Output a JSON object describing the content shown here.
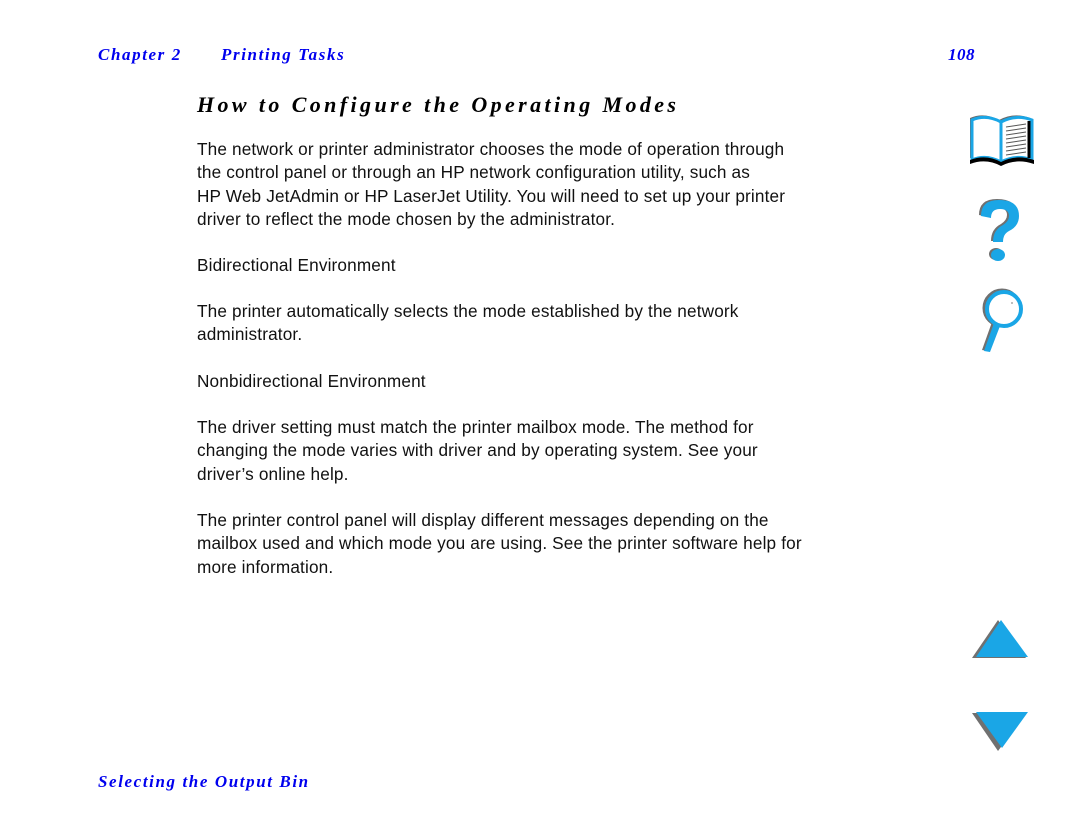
{
  "header": {
    "chapter": "Chapter 2",
    "section": "Printing Tasks",
    "page_number": "108"
  },
  "title": "How to Configure the Operating Modes",
  "paragraphs": [
    {
      "lines": [
        "The network or printer administrator chooses the mode of operation through",
        "the control panel or through an HP network configuration utility, such as",
        "HP Web JetAdmin or HP LaserJet Utility. You will need to set up your printer",
        "driver to reflect the mode chosen by the administrator."
      ]
    },
    {
      "lines": [
        "Bidirectional Environment"
      ]
    },
    {
      "lines": [
        "The printer automatically selects the mode established by the network",
        "administrator."
      ]
    },
    {
      "lines": [
        "Nonbidirectional Environment"
      ]
    },
    {
      "lines": [
        "The driver setting must match the printer mailbox mode. The method for",
        "changing the mode varies with driver and by operating system. See your",
        "driver’s online help."
      ]
    },
    {
      "lines": [
        "The printer control panel will display different messages depending on the",
        "mailbox used and which mode you are using. See the printer software help for",
        "more information."
      ]
    }
  ],
  "footer": {
    "link_text": "Selecting the Output Bin"
  },
  "nav_icons": {
    "contents": "book-icon",
    "help": "question-mark-icon",
    "index": "magnifier-icon",
    "previous_page": "up-triangle-icon",
    "next_page": "down-triangle-icon"
  },
  "colors": {
    "link_blue": "#0000ee",
    "icon_fill": "#1aa6e6",
    "icon_shadow": "#707070"
  }
}
